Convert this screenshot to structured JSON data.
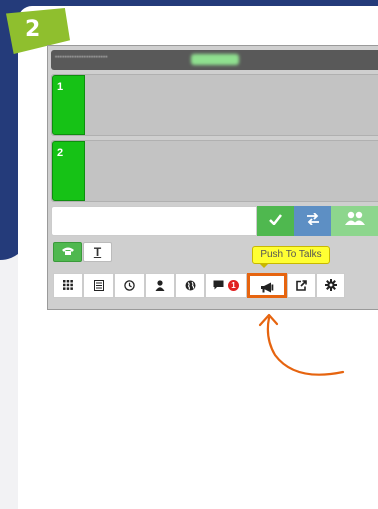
{
  "step": {
    "number": "2"
  },
  "session_bar": {
    "text": "••••••••••••••••••••••"
  },
  "lines": [
    {
      "number": "1"
    },
    {
      "number": "2"
    }
  ],
  "dial": {
    "value": "",
    "placeholder": ""
  },
  "actions": {
    "call_icon": "check-icon",
    "transfer_icon": "transfer-icon",
    "conference_icon": "group-icon"
  },
  "modes": {
    "phone_icon": "phone-icon",
    "text_label": "T"
  },
  "tooltip": {
    "text": "Push To Talks"
  },
  "toolbar": {
    "chat_unread": "1",
    "icons": [
      "grid-icon",
      "list-icon",
      "clock-icon",
      "user-icon",
      "globe-icon",
      "chat-icon",
      "megaphone-icon",
      "share-icon",
      "gear-icon"
    ]
  },
  "colors": {
    "navy": "#243b7a",
    "badge_green": "#8fbf2e",
    "line_green": "#16c216",
    "highlight_orange": "#e6640f",
    "tooltip_yellow": "#ffff33"
  }
}
